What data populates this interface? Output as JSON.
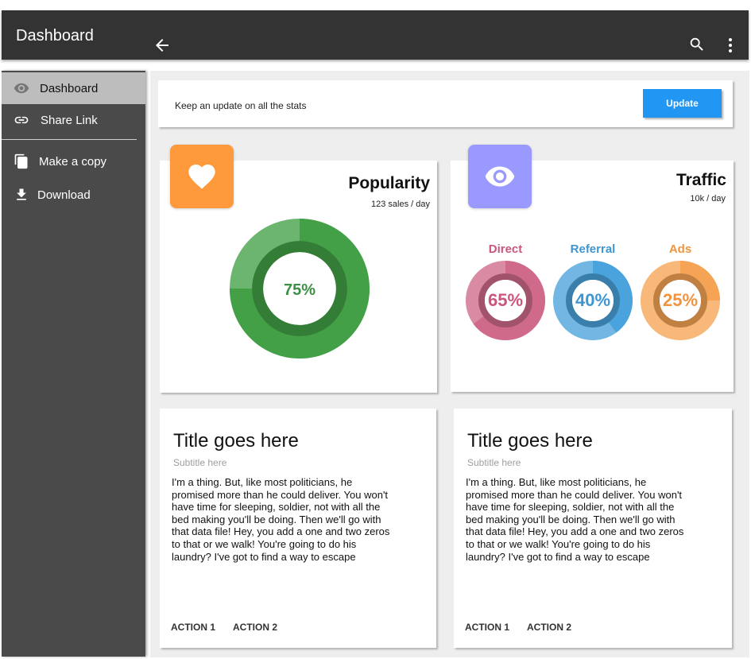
{
  "appbar": {
    "title": "Dashboard",
    "icons": [
      "arrow-back-icon",
      "search-icon",
      "more-vert-icon"
    ]
  },
  "sidebar": {
    "items": [
      {
        "label": "Dashboard",
        "icon": "eye-icon",
        "active": true
      },
      {
        "label": "Share Link",
        "icon": "link-icon"
      },
      {
        "label": "Make a copy",
        "icon": "copy-icon"
      },
      {
        "label": "Download",
        "icon": "download-icon"
      }
    ]
  },
  "update_card": {
    "text": "Keep an update on all the stats",
    "button": "Update"
  },
  "popularity": {
    "icon": "heart-icon",
    "title": "Popularity",
    "subtitle": "123 sales / day",
    "percent_label": "75%",
    "percent": 75,
    "color": "#43a047"
  },
  "traffic": {
    "icon": "eye-icon",
    "title": "Traffic",
    "subtitle": "10k / day",
    "sources": [
      {
        "label": "Direct",
        "percent_label": "65%",
        "percent": 65,
        "color": "#d06a8a"
      },
      {
        "label": "Referral",
        "percent_label": "40%",
        "percent": 40,
        "color": "#4aa3dc"
      },
      {
        "label": "Ads",
        "percent_label": "25%",
        "percent": 25,
        "color": "#f5a455"
      }
    ]
  },
  "posts": [
    {
      "title": "Title goes here",
      "subtitle": "Subtitle here",
      "body": "I'm a thing. But, like most politicians, he promised more than he could deliver. You won't have time for sleeping, soldier, not with all the bed making you'll be doing. Then we'll go with that data file! Hey, you add a one and two zeros to that or we walk! You're going to do his laundry? I've got to find a way to escape",
      "actions": [
        "ACTION 1",
        "ACTION 2"
      ]
    },
    {
      "title": "Title goes here",
      "subtitle": "Subtitle here",
      "body": "I'm a thing. But, like most politicians, he promised more than he could deliver. You won't have time for sleeping, soldier, not with all the bed making you'll be doing. Then we'll go with that data file! Hey, you add a one and two zeros to that or we walk! You're going to do his laundry? I've got to find a way to escape",
      "actions": [
        "ACTION 1",
        "ACTION 2"
      ]
    }
  ],
  "colors": {
    "appbar": "#333333",
    "sidebar": "#4a4a4a",
    "accent": "#2196f3",
    "popularity_badge": "#ff9a3c",
    "traffic_badge": "#9999ff"
  }
}
